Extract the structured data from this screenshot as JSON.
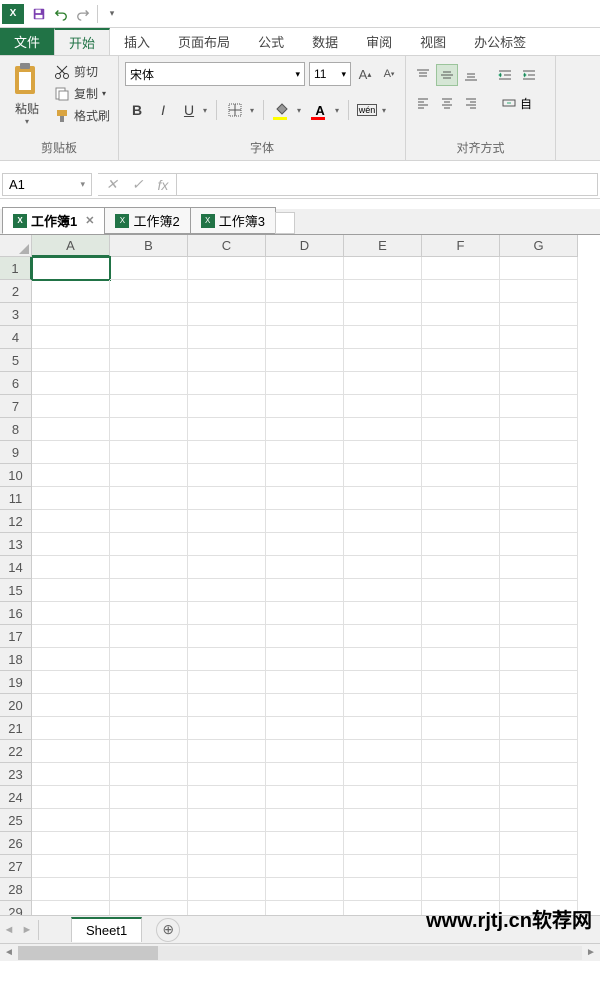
{
  "qat": {
    "app": "X"
  },
  "tabs": {
    "file": "文件",
    "home": "开始",
    "insert": "插入",
    "layout": "页面布局",
    "formula": "公式",
    "data": "数据",
    "review": "审阅",
    "view": "视图",
    "office": "办公标签"
  },
  "clipboard": {
    "paste": "粘贴",
    "cut": "剪切",
    "copy": "复制",
    "format": "格式刷",
    "label": "剪贴板"
  },
  "font": {
    "name": "宋体",
    "size": "11",
    "bold": "B",
    "italic": "I",
    "under": "U",
    "wen": "wén",
    "label": "字体",
    "aplus": "A",
    "aminus": "A"
  },
  "align": {
    "label": "对齐方式",
    "merge": "自"
  },
  "namebox": "A1",
  "fb": {
    "fx": "fx"
  },
  "workbooks": {
    "w1": "工作簿1",
    "w2": "工作簿2",
    "w3": "工作簿3"
  },
  "cols": {
    "a": "A",
    "b": "B",
    "c": "C",
    "d": "D",
    "e": "E",
    "f": "F",
    "g": "G"
  },
  "rows": {
    "r1": "1",
    "r2": "2",
    "r3": "3",
    "r4": "4",
    "r5": "5",
    "r6": "6",
    "r7": "7",
    "r8": "8",
    "r9": "9",
    "r10": "10",
    "r11": "11",
    "r12": "12",
    "r13": "13",
    "r14": "14",
    "r15": "15",
    "r16": "16",
    "r17": "17",
    "r18": "18",
    "r19": "19",
    "r20": "20",
    "r21": "21",
    "r22": "22",
    "r23": "23",
    "r24": "24",
    "r25": "25",
    "r26": "26",
    "r27": "27",
    "r28": "28",
    "r29": "29"
  },
  "sheet": {
    "name": "Sheet1"
  },
  "watermark": "www.rjtj.cn软荐网"
}
